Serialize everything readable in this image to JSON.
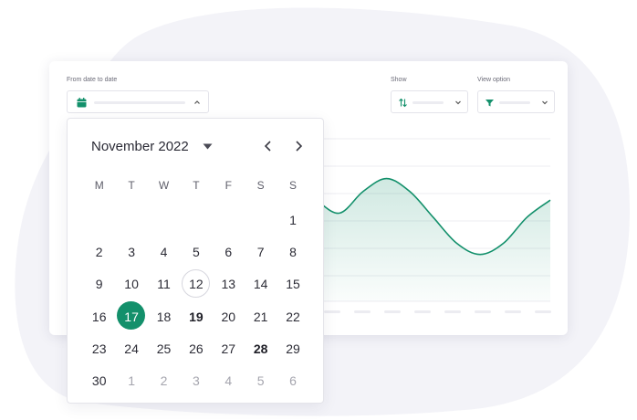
{
  "filters": {
    "date_range": {
      "label": "From date to date"
    },
    "show": {
      "label": "Show"
    },
    "view_option": {
      "label": "View option"
    }
  },
  "chart_data": {
    "type": "area",
    "x": [
      0,
      1,
      2,
      3,
      4,
      5,
      6,
      7,
      8,
      9,
      10,
      11,
      12,
      13,
      14,
      15,
      16,
      17,
      18,
      19,
      20
    ],
    "values": [
      0.05,
      0.2,
      0.45,
      0.68,
      0.72,
      0.58,
      0.45,
      0.58,
      0.78,
      0.95,
      0.75,
      0.6,
      0.85,
      1.0,
      0.85,
      0.55,
      0.25,
      0.12,
      0.25,
      0.55,
      0.75
    ],
    "ylim": [
      0,
      1
    ],
    "grid": true
  },
  "calendar": {
    "month_label": "November 2022",
    "weekdays": [
      "M",
      "T",
      "W",
      "T",
      "F",
      "S",
      "S"
    ],
    "weeks": [
      [
        {
          "d": ""
        },
        {
          "d": ""
        },
        {
          "d": ""
        },
        {
          "d": ""
        },
        {
          "d": ""
        },
        {
          "d": ""
        },
        {
          "d": "1"
        }
      ],
      [
        {
          "d": "2"
        },
        {
          "d": "3"
        },
        {
          "d": "4"
        },
        {
          "d": "5"
        },
        {
          "d": "6"
        },
        {
          "d": "7"
        },
        {
          "d": "8"
        }
      ],
      [
        {
          "d": "9"
        },
        {
          "d": "10"
        },
        {
          "d": "11"
        },
        {
          "d": "12",
          "s": "today"
        },
        {
          "d": "13"
        },
        {
          "d": "14"
        },
        {
          "d": "15"
        }
      ],
      [
        {
          "d": "16"
        },
        {
          "d": "17",
          "s": "selected"
        },
        {
          "d": "18"
        },
        {
          "d": "19",
          "s": "bold"
        },
        {
          "d": "20"
        },
        {
          "d": "21"
        },
        {
          "d": "22"
        }
      ],
      [
        {
          "d": "23"
        },
        {
          "d": "24"
        },
        {
          "d": "25"
        },
        {
          "d": "26"
        },
        {
          "d": "27"
        },
        {
          "d": "28",
          "s": "bold"
        },
        {
          "d": "29"
        }
      ],
      [
        {
          "d": "30"
        },
        {
          "d": "1",
          "s": "other"
        },
        {
          "d": "2",
          "s": "other"
        },
        {
          "d": "3",
          "s": "other"
        },
        {
          "d": "4",
          "s": "other"
        },
        {
          "d": "5",
          "s": "other"
        },
        {
          "d": "6",
          "s": "other"
        }
      ]
    ]
  },
  "colors": {
    "accent": "#13906b",
    "blob": "#f3f3f8"
  },
  "icons": {
    "date_field": "calendar-icon",
    "show_field": "sort-arrows-icon",
    "view_field": "filter-funnel-icon"
  }
}
